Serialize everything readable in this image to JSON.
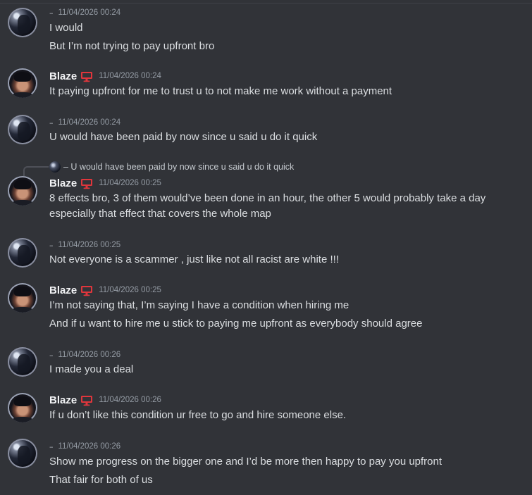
{
  "messages": [
    {
      "author": "",
      "dash": "–",
      "timestamp": "11/04/2026 00:24",
      "lines": [
        "I would",
        "But I’m not trying to pay upfront bro"
      ]
    },
    {
      "author": "Blaze",
      "timestamp": "11/04/2026 00:24",
      "lines": [
        "It paying upfront for me to trust u to not make me work without a payment"
      ]
    },
    {
      "author": "",
      "dash": "–",
      "timestamp": "11/04/2026 00:24",
      "lines": [
        "U would have been paid by now since u said u do it quick"
      ]
    },
    {
      "author": "Blaze",
      "timestamp": "11/04/2026 00:25",
      "reply": "– U would have been paid by now since u said u do it quick",
      "lines": [
        "8 effects bro, 3 of them would’ve been done in an hour, the other 5 would probably take a day",
        "especially that effect that covers the whole map"
      ]
    },
    {
      "author": "",
      "dash": "–",
      "timestamp": "11/04/2026 00:25",
      "lines": [
        "Not everyone is a scammer , just like not all racist are white !!!"
      ]
    },
    {
      "author": "Blaze",
      "timestamp": "11/04/2026 00:25",
      "lines": [
        "I’m not saying that, I’m saying I have a condition when hiring me",
        "And if u want to hire me u stick to paying me upfront as everybody should agree"
      ]
    },
    {
      "author": "",
      "dash": "–",
      "timestamp": "11/04/2026 00:26",
      "lines": [
        "I made you a deal"
      ]
    },
    {
      "author": "Blaze",
      "timestamp": "11/04/2026 00:26",
      "lines": [
        "If u don’t like this condition ur free to go and hire someone else."
      ]
    },
    {
      "author": "",
      "dash": "–",
      "timestamp": "11/04/2026 00:26",
      "lines": [
        "Show me progress on the bigger one and I’d be more then happy to pay you upfront",
        "That fair for both of us"
      ]
    }
  ],
  "icons": {
    "badge": "monitor-icon",
    "badge_color": "#e0363c"
  }
}
